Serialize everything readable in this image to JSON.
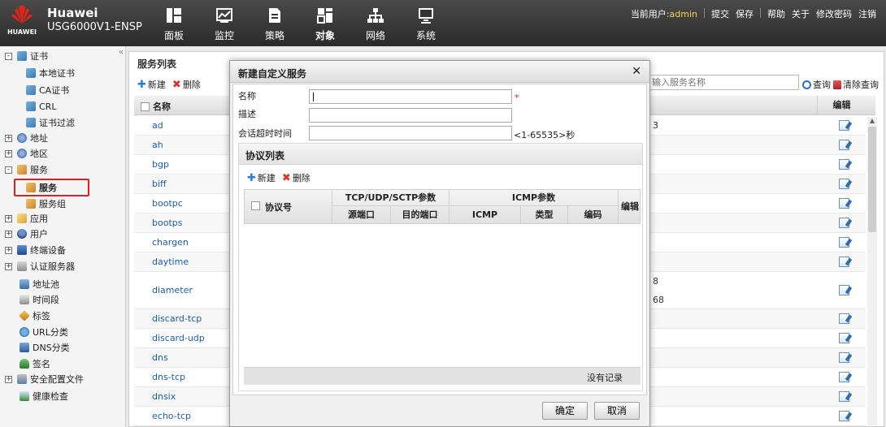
{
  "header": {
    "brand": "Huawei",
    "model": "USG6000V1-ENSP",
    "logo_text": "HUAWEI",
    "nav": [
      {
        "label": "面板",
        "icon": "dashboard-icon"
      },
      {
        "label": "监控",
        "icon": "monitor-icon"
      },
      {
        "label": "策略",
        "icon": "policy-icon"
      },
      {
        "label": "对象",
        "icon": "object-icon"
      },
      {
        "label": "网络",
        "icon": "network-icon"
      },
      {
        "label": "系统",
        "icon": "system-icon"
      }
    ],
    "active_nav": "对象",
    "user_label": "当前用户:",
    "username": "admin",
    "links": [
      "提交",
      "保存",
      "帮助",
      "关于",
      "修改密码",
      "注销"
    ]
  },
  "sidebar": {
    "items": [
      {
        "label": "证书",
        "toggle": "-",
        "icon": "certificate-icon"
      },
      {
        "label": "本地证书",
        "icon": "certificate-icon"
      },
      {
        "label": "CA证书",
        "icon": "certificate-icon"
      },
      {
        "label": "CRL",
        "icon": "certificate-icon"
      },
      {
        "label": "证书过滤",
        "icon": "certificate-icon"
      },
      {
        "label": "地址",
        "toggle": "+",
        "icon": "address-icon"
      },
      {
        "label": "地区",
        "toggle": "+",
        "icon": "region-icon"
      },
      {
        "label": "服务",
        "toggle": "-",
        "icon": "service-icon"
      },
      {
        "label": "服务",
        "icon": "service-icon",
        "selected": true
      },
      {
        "label": "服务组",
        "icon": "service-group-icon"
      },
      {
        "label": "应用",
        "toggle": "+",
        "icon": "application-icon"
      },
      {
        "label": "用户",
        "toggle": "+",
        "icon": "user-icon"
      },
      {
        "label": "终端设备",
        "toggle": "+",
        "icon": "terminal-device-icon"
      },
      {
        "label": "认证服务器",
        "toggle": "+",
        "icon": "auth-server-icon"
      },
      {
        "label": "地址池",
        "icon": "address-pool-icon"
      },
      {
        "label": "时间段",
        "icon": "time-range-icon"
      },
      {
        "label": "标签",
        "icon": "tag-icon"
      },
      {
        "label": "URL分类",
        "icon": "url-category-icon"
      },
      {
        "label": "DNS分类",
        "icon": "dns-category-icon"
      },
      {
        "label": "签名",
        "icon": "signature-icon"
      },
      {
        "label": "安全配置文件",
        "toggle": "+",
        "icon": "security-profile-icon"
      },
      {
        "label": "健康检查",
        "icon": "health-check-icon"
      }
    ]
  },
  "main": {
    "title": "服务列表",
    "new_label": "新建",
    "delete_label": "删除",
    "search_placeholder": "输入服务名称",
    "query_label": "查询",
    "clear_label": "清除查询",
    "col_name": "名称",
    "col_edit": "编辑",
    "rows": [
      {
        "name": "ad",
        "extra": "3"
      },
      {
        "name": "ah",
        "extra": ""
      },
      {
        "name": "bgp",
        "extra": ""
      },
      {
        "name": "biff",
        "extra": ""
      },
      {
        "name": "bootpc",
        "extra": ""
      },
      {
        "name": "bootps",
        "extra": ""
      },
      {
        "name": "chargen",
        "extra": ""
      },
      {
        "name": "daytime",
        "extra": ""
      },
      {
        "name": "diameter",
        "extra": "8",
        "extra2": "68"
      },
      {
        "name": "discard-tcp",
        "extra": ""
      },
      {
        "name": "discard-udp",
        "extra": ""
      },
      {
        "name": "dns",
        "extra": ""
      },
      {
        "name": "dns-tcp",
        "extra": ""
      },
      {
        "name": "dnsix",
        "extra": ""
      },
      {
        "name": "echo-tcp",
        "extra": ""
      }
    ]
  },
  "dialog": {
    "title": "新建自定义服务",
    "name_label": "名称",
    "name_value": "",
    "required_mark": "*",
    "desc_label": "描述",
    "desc_value": "",
    "timeout_label": "会话超时时间",
    "timeout_value": "",
    "timeout_hint": "<1-65535>秒",
    "proto_title": "协议列表",
    "proto_new": "新建",
    "proto_delete": "删除",
    "col_protocol": "协议号",
    "col_tcpudp": "TCP/UDP/SCTP参数",
    "col_icmp_params": "ICMP参数",
    "col_edit": "编辑",
    "col_src_port": "源端口",
    "col_dst_port": "目的端口",
    "col_icmp": "ICMP",
    "col_type": "类型",
    "col_code": "编码",
    "no_record": "没有记录",
    "ok_label": "确定",
    "cancel_label": "取消"
  }
}
